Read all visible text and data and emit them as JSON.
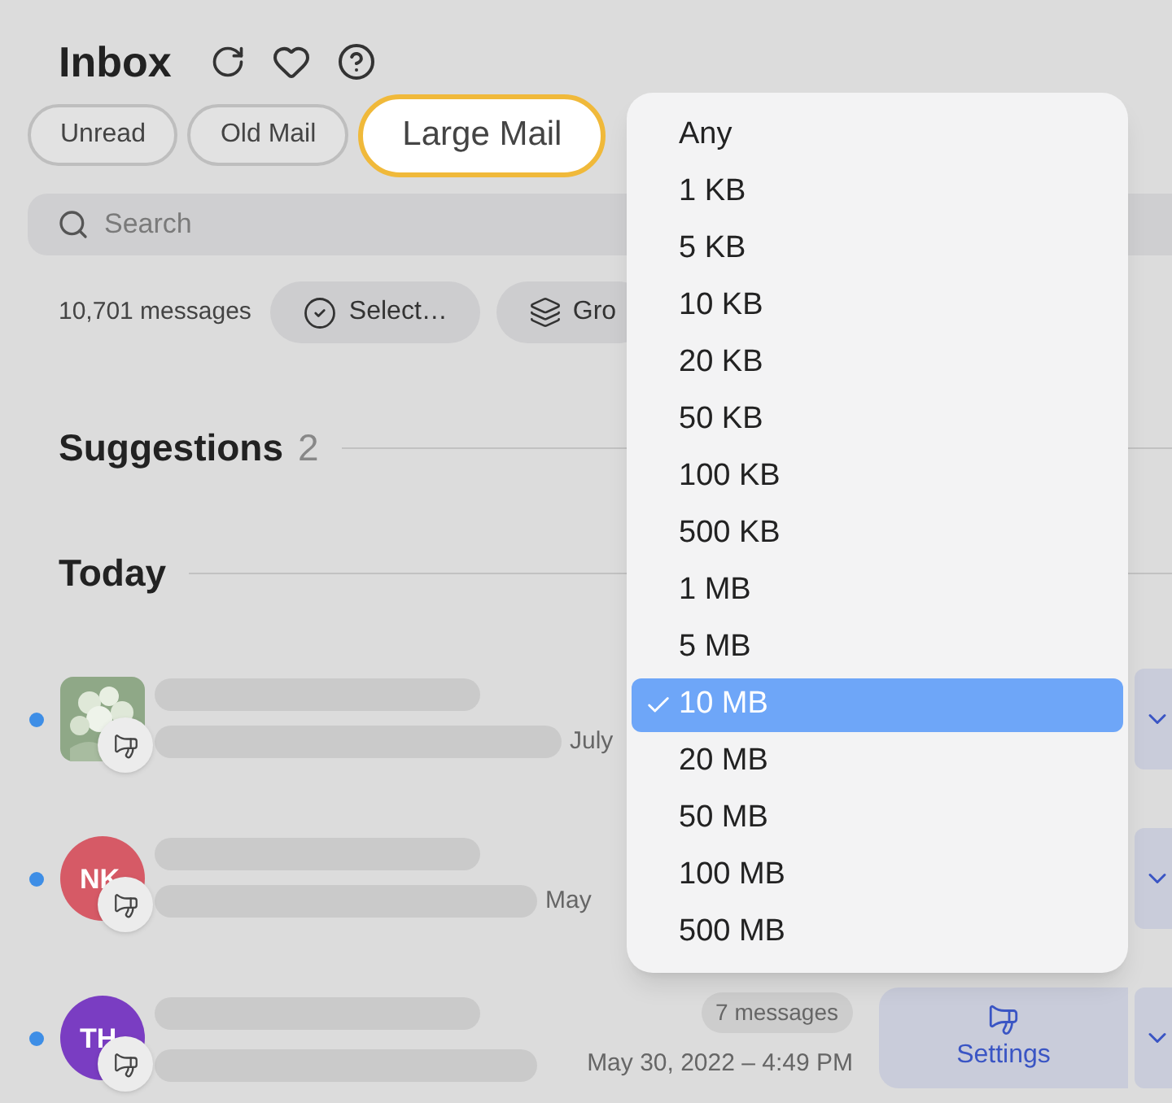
{
  "header": {
    "title": "Inbox"
  },
  "filters": [
    {
      "label": "Unread",
      "selected": false
    },
    {
      "label": "Old Mail",
      "selected": false
    },
    {
      "label": "Large Mail",
      "selected": true
    }
  ],
  "search": {
    "placeholder": "Search"
  },
  "toolbar": {
    "count": "10,701 messages",
    "buttons": [
      {
        "kind": "select",
        "label": "Select…"
      },
      {
        "kind": "group",
        "label": "Gro"
      }
    ]
  },
  "sections": [
    {
      "title": "Suggestions",
      "count": "2"
    },
    {
      "title": "Today"
    }
  ],
  "messages": [
    {
      "unread": true,
      "date": "July"
    },
    {
      "unread": true,
      "avatar": {
        "kind": "initials",
        "initials": "NK",
        "color": "#d65a66"
      },
      "date": "May"
    },
    {
      "unread": true,
      "avatar": {
        "kind": "initials",
        "initials": "TH",
        "color": "#7a3dc2"
      },
      "thread_count": "7 messages",
      "date": "May 30, 2022 – 4:49 PM",
      "action": "Settings"
    }
  ],
  "size_menu": {
    "options": [
      {
        "label": "Any",
        "selected": false
      },
      {
        "label": "1 KB",
        "selected": false
      },
      {
        "label": "5 KB",
        "selected": false
      },
      {
        "label": "10 KB",
        "selected": false
      },
      {
        "label": "20 KB",
        "selected": false
      },
      {
        "label": "50 KB",
        "selected": false
      },
      {
        "label": "100 KB",
        "selected": false
      },
      {
        "label": "500 KB",
        "selected": false
      },
      {
        "label": "1 MB",
        "selected": false
      },
      {
        "label": "5 MB",
        "selected": false
      },
      {
        "label": "10 MB",
        "selected": true
      },
      {
        "label": "20 MB",
        "selected": false
      },
      {
        "label": "50 MB",
        "selected": false
      },
      {
        "label": "100 MB",
        "selected": false
      },
      {
        "label": "500 MB",
        "selected": false
      }
    ]
  }
}
